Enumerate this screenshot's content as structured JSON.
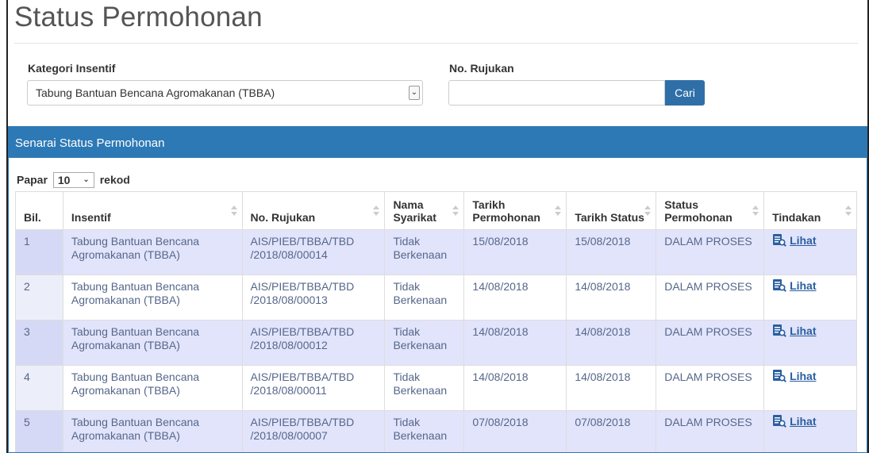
{
  "page": {
    "title": "Status Permohonan"
  },
  "filters": {
    "kategori_label": "Kategori Insentif",
    "kategori_value": "Tabung Bantuan Bencana Agromakanan (TBBA)",
    "rujukan_label": "No. Rujukan",
    "rujukan_value": "",
    "search_button": "Cari"
  },
  "panel": {
    "title": "Senarai Status Permohonan",
    "show_prefix": "Papar",
    "show_value": "10",
    "show_suffix": "rekod"
  },
  "table": {
    "headers": [
      "Bil.",
      "Insentif",
      "No. Rujukan",
      "Nama Syarikat",
      "Tarikh Permohonan",
      "Tarikh Status",
      "Status Permohonan",
      "Tindakan"
    ],
    "rows": [
      {
        "bil": "1",
        "insentif": "Tabung Bantuan Bencana Agromakanan (TBBA)",
        "rujukan": "AIS/PIEB/TBBA/TBD /2018/08/00014",
        "syarikat": "Tidak Berkenaan",
        "tarikh_permohonan": "15/08/2018",
        "tarikh_status": "15/08/2018",
        "status": "DALAM PROSES",
        "action": "Lihat"
      },
      {
        "bil": "2",
        "insentif": "Tabung Bantuan Bencana Agromakanan (TBBA)",
        "rujukan": "AIS/PIEB/TBBA/TBD /2018/08/00013",
        "syarikat": "Tidak Berkenaan",
        "tarikh_permohonan": "14/08/2018",
        "tarikh_status": "14/08/2018",
        "status": "DALAM PROSES",
        "action": "Lihat"
      },
      {
        "bil": "3",
        "insentif": "Tabung Bantuan Bencana Agromakanan (TBBA)",
        "rujukan": "AIS/PIEB/TBBA/TBD /2018/08/00012",
        "syarikat": "Tidak Berkenaan",
        "tarikh_permohonan": "14/08/2018",
        "tarikh_status": "14/08/2018",
        "status": "DALAM PROSES",
        "action": "Lihat"
      },
      {
        "bil": "4",
        "insentif": "Tabung Bantuan Bencana Agromakanan (TBBA)",
        "rujukan": "AIS/PIEB/TBBA/TBD /2018/08/00011",
        "syarikat": "Tidak Berkenaan",
        "tarikh_permohonan": "14/08/2018",
        "tarikh_status": "14/08/2018",
        "status": "DALAM PROSES",
        "action": "Lihat"
      },
      {
        "bil": "5",
        "insentif": "Tabung Bantuan Bencana Agromakanan (TBBA)",
        "rujukan": "AIS/PIEB/TBBA/TBD /2018/08/00007",
        "syarikat": "Tidak Berkenaan",
        "tarikh_permohonan": "07/08/2018",
        "tarikh_status": "07/08/2018",
        "status": "DALAM PROSES",
        "action": "Lihat"
      }
    ]
  },
  "colors": {
    "accent": "#2d79b6",
    "button": "#2f6fa8",
    "row_odd": "#e2e4fb",
    "link": "#2a5fa0"
  },
  "icons": {
    "action_icon": "document-search-icon",
    "select_icon": "chevron-down-icon"
  }
}
